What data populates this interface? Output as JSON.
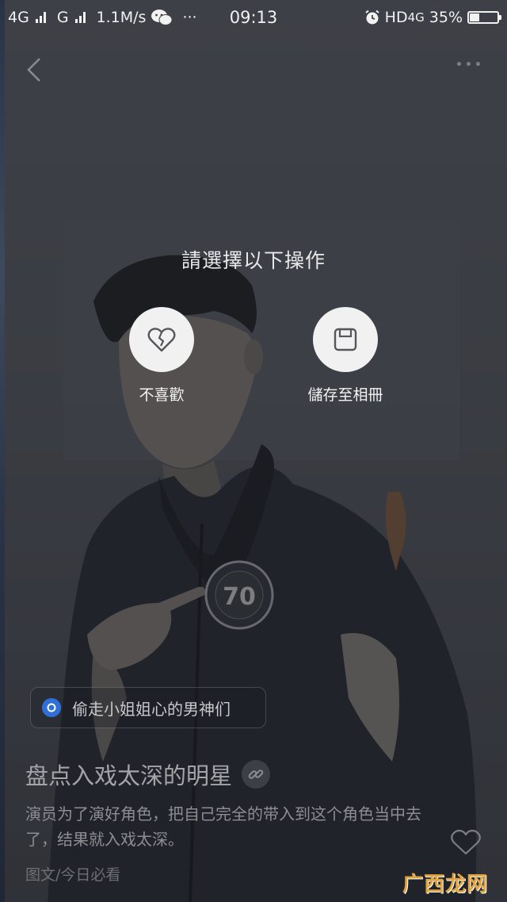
{
  "status_bar": {
    "network1": "4G",
    "network2": "G",
    "speed": "1.1M/s",
    "dots": "···",
    "time": "09:13",
    "hd": "HD",
    "network3": "4G",
    "battery_level": 0.35,
    "battery_text": "35%"
  },
  "action_sheet": {
    "title": "請選擇以下操作",
    "actions": [
      {
        "label": "不喜歡",
        "icon": "broken-heart-icon"
      },
      {
        "label": "儲存至相冊",
        "icon": "save-icon"
      }
    ]
  },
  "article": {
    "topic": "偷走小姐姐心的男神们",
    "title": "盘点入戏太深的明星",
    "description": "演员为了演好角色，把自己完全的带入到这个角色当中去了，结果就入戏太深。",
    "source": "图文/今日必看"
  },
  "watermark": "广西龙网"
}
